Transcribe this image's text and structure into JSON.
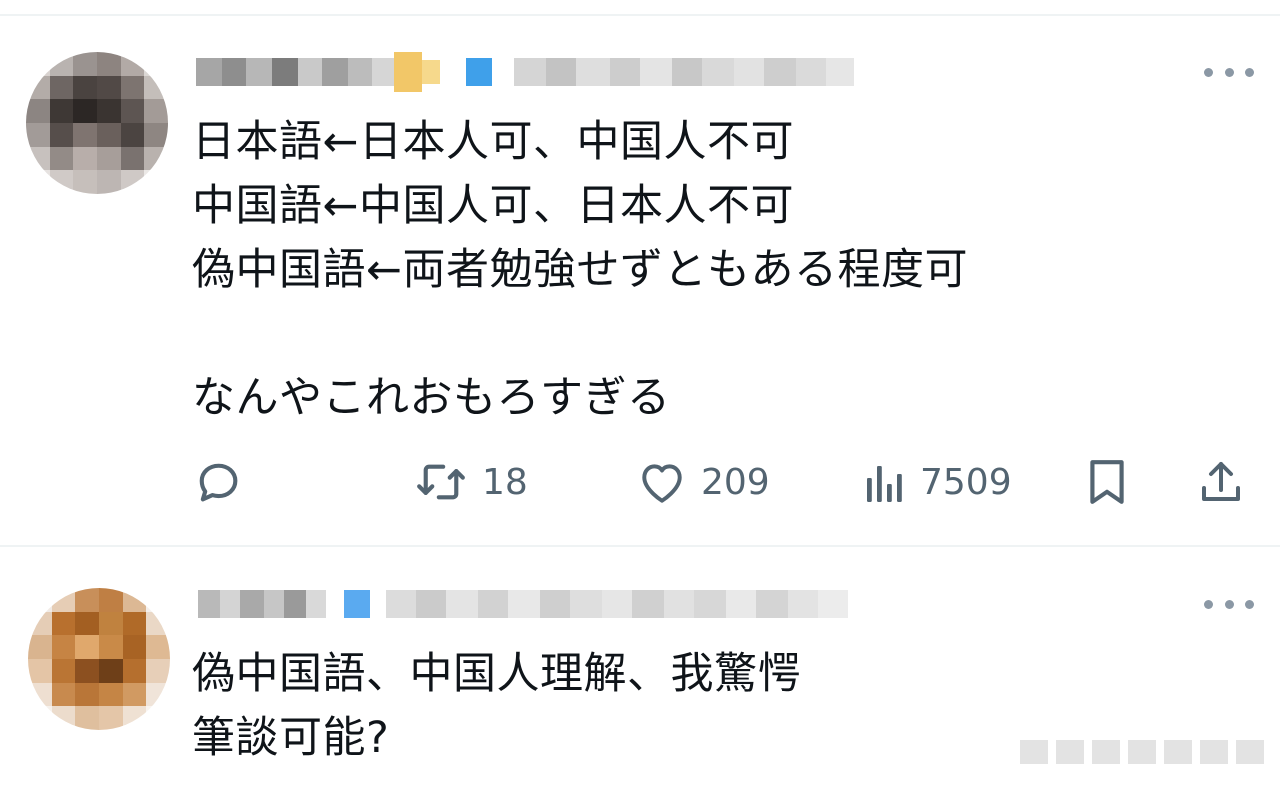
{
  "tweets": [
    {
      "lines": [
        "日本語←日本人可、中国人不可",
        "中国語←中国人可、日本人不可",
        "偽中国語←両者勉強せずともある程度可",
        "",
        "なんやこれおもろすぎる"
      ],
      "actions": {
        "reply_icon": "reply-bubble-icon",
        "retweet_count": "18",
        "like_count": "209",
        "views_count": "7509"
      }
    },
    {
      "lines": [
        "偽中国語、中国人理解、我驚愕",
        "筆談可能?"
      ]
    }
  ],
  "colors": {
    "text": "#0f1419",
    "secondary": "#536471",
    "divider": "#eff3f4",
    "verified_badge": "#1d9bf0"
  }
}
